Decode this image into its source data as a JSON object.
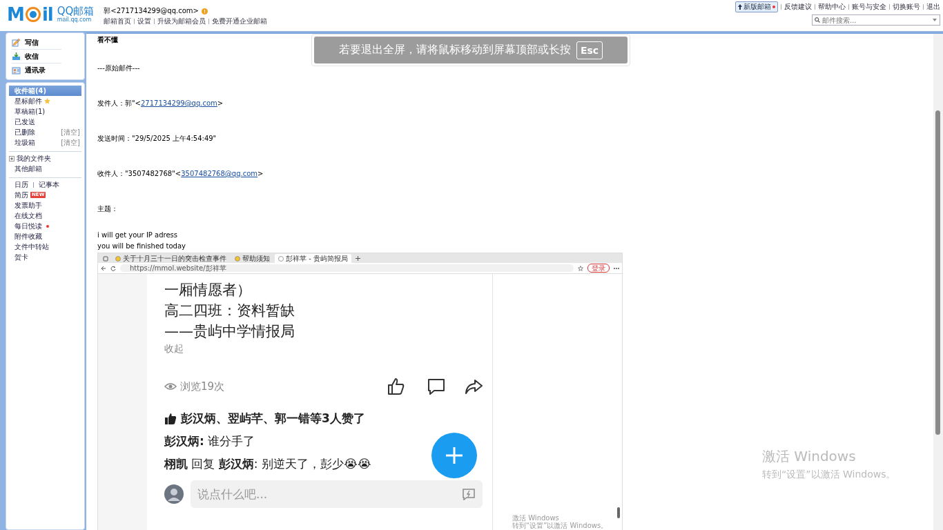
{
  "header": {
    "logo_letters": [
      "M",
      "il"
    ],
    "logo_title": "QQ邮箱",
    "logo_domain": "mail.qq.com",
    "account": "郭<2717134299@qq.com>",
    "links": [
      "邮箱首页",
      "设置",
      "升级为邮箱会员",
      "免费开通企业邮箱"
    ],
    "new_version": "新版邮箱",
    "top_links": [
      "反馈建议",
      "帮助中心",
      "账号与安全",
      "切换账号",
      "退出"
    ],
    "search": {
      "placeholder": "邮件搜索..."
    }
  },
  "sidebar": {
    "quick": [
      {
        "kind": "write",
        "label": "写信"
      },
      {
        "kind": "inbox",
        "label": "收信"
      },
      {
        "kind": "contacts",
        "label": "通讯录"
      }
    ],
    "folders": [
      {
        "kind": "plain",
        "label": "收件箱(4)",
        "selected": true
      },
      {
        "kind": "star",
        "label": "星标邮件",
        "selected": false
      },
      {
        "kind": "plain",
        "label": "草稿箱(1)",
        "selected": false
      },
      {
        "kind": "plain",
        "label": "已发送",
        "selected": false
      },
      {
        "kind": "clear",
        "label": "已删除",
        "action": "[清空]",
        "selected": false
      },
      {
        "kind": "clear",
        "label": "垃圾箱",
        "action": "[清空]",
        "selected": false
      }
    ],
    "my_folders": [
      {
        "label": "我的文件夹",
        "expanded": false
      },
      {
        "label": "其他邮箱"
      }
    ],
    "tools": [
      {
        "kind": "pair",
        "labels": [
          "日历",
          "记事本"
        ]
      },
      {
        "kind": "badge",
        "label": "简历",
        "badge": "NEW"
      },
      {
        "kind": "plain",
        "label": "发票助手"
      },
      {
        "kind": "plain",
        "label": "在线文档"
      },
      {
        "kind": "dot",
        "label": "每日悦读"
      },
      {
        "kind": "plain",
        "label": "附件收藏"
      },
      {
        "kind": "plain",
        "label": "文件中转站"
      },
      {
        "kind": "plain",
        "label": "贺卡"
      }
    ]
  },
  "mail": {
    "paragraphs": [
      {
        "kind": "text",
        "text": "看不懂"
      },
      {
        "kind": "text",
        "text": "---原始邮件---"
      },
      {
        "kind": "link",
        "prefix": "发件人：郭\"<",
        "link": "2717134299@qq.com",
        "suffix": ">"
      },
      {
        "kind": "text",
        "text": "发送时间：\"29/5/2025 上午4:54:49\""
      },
      {
        "kind": "link",
        "prefix": "收件人：\"3507482768\"<",
        "link": "3507482768@qq.com",
        "suffix": ">"
      },
      {
        "kind": "text",
        "text": "主题："
      },
      {
        "kind": "lines",
        "lines": [
          "i will get your IP adress",
          "you will be finished today"
        ]
      }
    ],
    "screenshot": {
      "tabs": [
        {
          "title": "关于十月三十一日的突击检查事件",
          "selected": false
        },
        {
          "title": "帮助须知",
          "selected": false
        },
        {
          "title": "彭祥苹 - 贵屿简报局",
          "selected": true
        }
      ],
      "url": "https://mmol.website/彭祥苹",
      "login": "登录",
      "lines": [
        "一厢情愿者）",
        "高二四班：资料暂缺",
        "——贵屿中学情报局"
      ],
      "collapse": "收起",
      "views": "浏览19次",
      "likes": "彭汉炳、翌屿芊、郭一错等3人赞了",
      "comments": [
        "**彭汉炳:** 谁分手了",
        "**栩凯** 回复 **彭汉炳**: 别逆天了，彭少😭😭"
      ],
      "comment_placeholder": "说点什么吧...",
      "activation": {
        "title": "激活 Windows",
        "subtitle": "转到“设置”以激活 Windows。"
      }
    }
  },
  "fullscreen_notice": {
    "text": "若要退出全屏，请将鼠标移动到屏幕顶部或长按",
    "key": "Esc"
  },
  "activation": {
    "title": "激活 Windows",
    "subtitle": "转到“设置”以激活 Windows。"
  }
}
